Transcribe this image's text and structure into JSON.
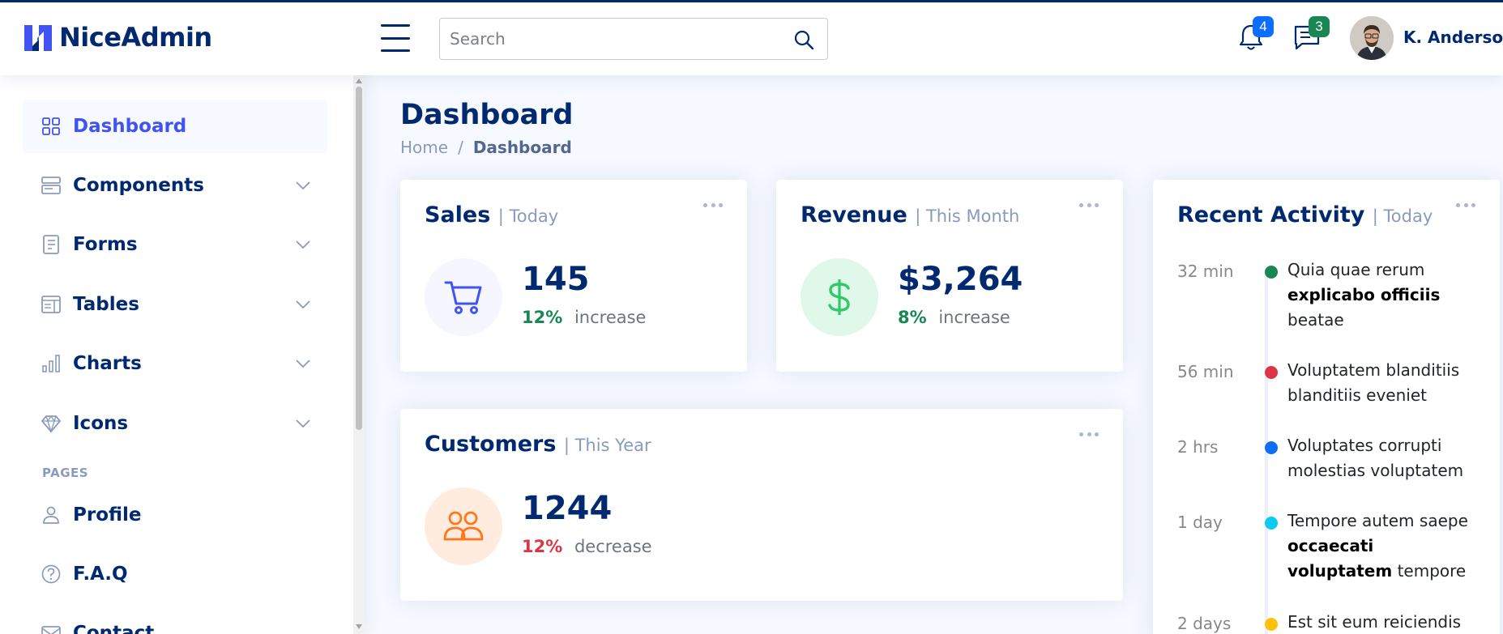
{
  "app": {
    "logo_text": "NiceAdmin"
  },
  "header": {
    "search_placeholder": "Search",
    "notifications_count": "4",
    "messages_count": "3",
    "username": "K. Anderson"
  },
  "sidebar": {
    "items": [
      {
        "label": "Dashboard",
        "icon": "grid-icon",
        "active": true
      },
      {
        "label": "Components",
        "icon": "menu-button-icon",
        "expandable": true
      },
      {
        "label": "Forms",
        "icon": "journal-text-icon",
        "expandable": true
      },
      {
        "label": "Tables",
        "icon": "layout-text-window-icon",
        "expandable": true
      },
      {
        "label": "Charts",
        "icon": "bar-chart-icon",
        "expandable": true
      },
      {
        "label": "Icons",
        "icon": "gem-icon",
        "expandable": true
      }
    ],
    "pages_heading": "PAGES",
    "pages": [
      {
        "label": "Profile",
        "icon": "person-icon"
      },
      {
        "label": "F.A.Q",
        "icon": "question-circle-icon"
      },
      {
        "label": "Contact",
        "icon": "envelope-icon"
      }
    ]
  },
  "main": {
    "title": "Dashboard",
    "breadcrumb": {
      "home": "Home",
      "separator": "/",
      "current": "Dashboard"
    }
  },
  "cards": {
    "sales": {
      "title": "Sales",
      "period": "| Today",
      "value": "145",
      "pct": "12%",
      "trend": "increase",
      "icon": "cart-icon",
      "accent": "#4154f1",
      "bg": "#f6f6fe"
    },
    "revenue": {
      "title": "Revenue",
      "period": "| This Month",
      "value": "$3,264",
      "pct": "8%",
      "trend": "increase",
      "icon": "currency-dollar-icon",
      "accent": "#2eca6a",
      "bg": "#e0f8e9"
    },
    "customers": {
      "title": "Customers",
      "period": "| This Year",
      "value": "1244",
      "pct": "12%",
      "trend": "decrease",
      "icon": "people-icon",
      "accent": "#ff771d",
      "bg": "#ffecdf"
    }
  },
  "activity": {
    "title": "Recent Activity",
    "period": "| Today",
    "items": [
      {
        "time": "32 min",
        "color": "#198754",
        "pre": "Quia quae rerum ",
        "bold": "explicabo officiis",
        "post": " beatae"
      },
      {
        "time": "56 min",
        "color": "#dc3545",
        "pre": "Voluptatem blanditiis blanditiis eveniet",
        "bold": "",
        "post": ""
      },
      {
        "time": "2 hrs",
        "color": "#0d6efd",
        "pre": "Voluptates corrupti molestias voluptatem",
        "bold": "",
        "post": ""
      },
      {
        "time": "1 day",
        "color": "#0dcaf0",
        "pre": "Tempore autem saepe ",
        "bold": "occaecati voluptatem",
        "post": " tempore"
      },
      {
        "time": "2 days",
        "color": "#ffc107",
        "pre": "Est sit eum reiciendis",
        "bold": "",
        "post": ""
      }
    ]
  }
}
